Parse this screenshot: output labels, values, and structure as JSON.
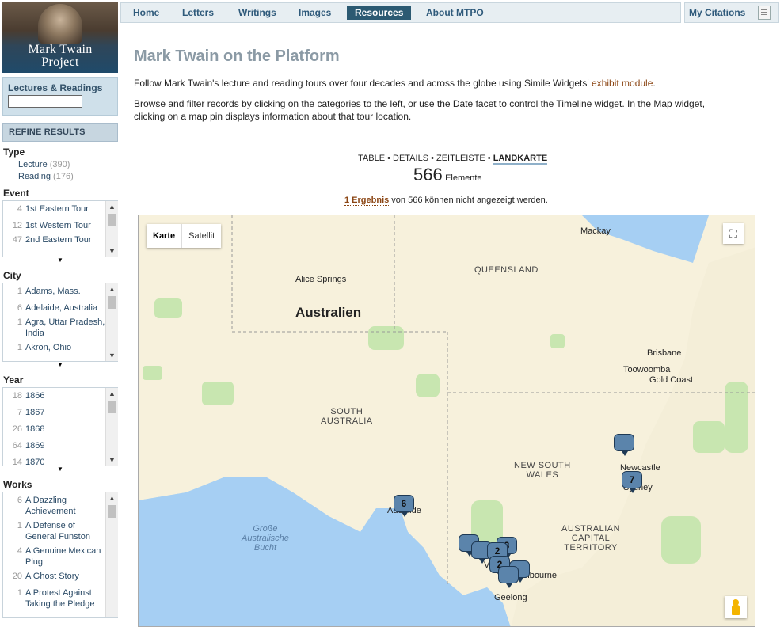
{
  "logo": {
    "line1": "Mark Twain",
    "line2": "Project"
  },
  "lectures_box": {
    "label": "Lectures & Readings",
    "value": ""
  },
  "refine": {
    "title": "REFINE RESULTS"
  },
  "facets": {
    "type": {
      "title": "Type",
      "rows": [
        {
          "label": "Lecture",
          "count": "(390)"
        },
        {
          "label": "Reading",
          "count": "(176)"
        }
      ]
    },
    "event": {
      "title": "Event",
      "rows": [
        {
          "count": "4",
          "label": "1st Eastern Tour"
        },
        {
          "count": "12",
          "label": "1st Western Tour"
        },
        {
          "count": "47",
          "label": "2nd Eastern Tour"
        }
      ]
    },
    "city": {
      "title": "City",
      "rows": [
        {
          "count": "1",
          "label": "Adams, Mass."
        },
        {
          "count": "6",
          "label": "Adelaide, Australia"
        },
        {
          "count": "1",
          "label": "Agra, Uttar Pradesh, India"
        },
        {
          "count": "1",
          "label": "Akron, Ohio"
        }
      ]
    },
    "year": {
      "title": "Year",
      "rows": [
        {
          "count": "18",
          "label": "1866"
        },
        {
          "count": "7",
          "label": "1867"
        },
        {
          "count": "26",
          "label": "1868"
        },
        {
          "count": "64",
          "label": "1869"
        },
        {
          "count": "14",
          "label": "1870"
        }
      ]
    },
    "works": {
      "title": "Works",
      "rows": [
        {
          "count": "6",
          "label": "A Dazzling Achievement"
        },
        {
          "count": "1",
          "label": "A Defense of General Funston"
        },
        {
          "count": "4",
          "label": "A Genuine Mexican Plug"
        },
        {
          "count": "20",
          "label": "A Ghost Story"
        },
        {
          "count": "1",
          "label": "A Protest Against Taking the Pledge"
        }
      ]
    }
  },
  "nav": {
    "items": [
      "Home",
      "Letters",
      "Writings",
      "Images",
      "Resources",
      "About MTPO"
    ],
    "active": "Resources"
  },
  "citations": {
    "label": "My Citations"
  },
  "main": {
    "title": "Mark Twain on the Platform",
    "para1_text": "Follow Mark Twain's lecture and reading tours over four decades and across the globe using Simile Widgets' ",
    "para1_link": "exhibit module",
    "para1_end": ".",
    "para2": "Browse and filter records by clicking on the categories to the left, or use the Date facet to control the Timeline widget. In the Map widget, clicking on a map pin displays information about that tour location."
  },
  "views": {
    "table": "TABLE",
    "details": "DETAILS",
    "timeline": "ZEITLEISTE",
    "map": "LANDKARTE",
    "sep": " • "
  },
  "items_count": {
    "number": "566",
    "label": "Elemente"
  },
  "warning": {
    "link": "1 Ergebnis",
    "text": " von 566 können nicht angezeigt werden."
  },
  "map": {
    "type_buttons": {
      "map": "Karte",
      "satellite": "Satellit"
    },
    "region_labels": {
      "queensland": "QUEENSLAND",
      "south_australia_1": "SOUTH",
      "south_australia_2": "AUSTRALIA",
      "nsw_1": "NEW SOUTH",
      "nsw_2": "WALES",
      "act_1": "AUSTRALIAN",
      "act_2": "CAPITAL",
      "act_3": "TERRITORY",
      "country": "Australien"
    },
    "bight_1": "Große",
    "bight_2": "Australische",
    "bight_3": "Bucht",
    "cities": {
      "mackay": "Mackay",
      "alice": "Alice Springs",
      "brisbane": "Brisbane",
      "toowoomba": "Toowoomba",
      "goldcoast": "Gold Coast",
      "newcastle": "Newcastle",
      "sydney": "Sydney",
      "adelaide": "Adelaide",
      "melbourne": "Melbourne",
      "geelong": "Geelong",
      "victoria": "Vict"
    },
    "pins": {
      "adelaide": "6",
      "sydney": "7",
      "newcastle": "",
      "vic1": "",
      "vic2": "2",
      "vic3": "2",
      "vic4": "3",
      "vic5": "",
      "vic6": ""
    }
  }
}
